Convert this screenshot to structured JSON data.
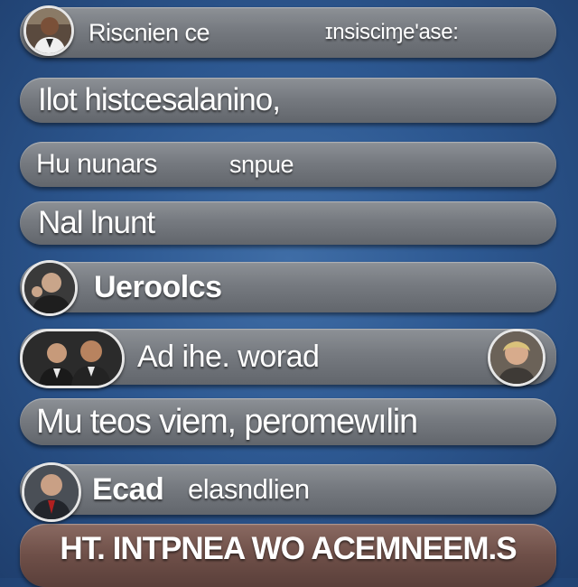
{
  "rows": [
    {
      "text": "Riscnien ce",
      "text2": "ɪnsisciɱe'ase:"
    },
    {
      "text": "Ilot histcesalanino,"
    },
    {
      "text": "Hu  nunars",
      "text2": "snpue"
    },
    {
      "text": "Nal lnunt"
    },
    {
      "text": "Ueroolcs"
    },
    {
      "text": "Ad ihe. worad"
    },
    {
      "text": "Mu teos viem, peromewılin"
    },
    {
      "text": "Ecad",
      "text2": "elasndlien"
    },
    {
      "text": "HT. INTPNEA WO ACEMNEEM.S"
    }
  ],
  "colors": {
    "background": "#2d5891",
    "pill": "#7a7e84",
    "banner": "#6e4f48",
    "text": "#ffffff"
  }
}
